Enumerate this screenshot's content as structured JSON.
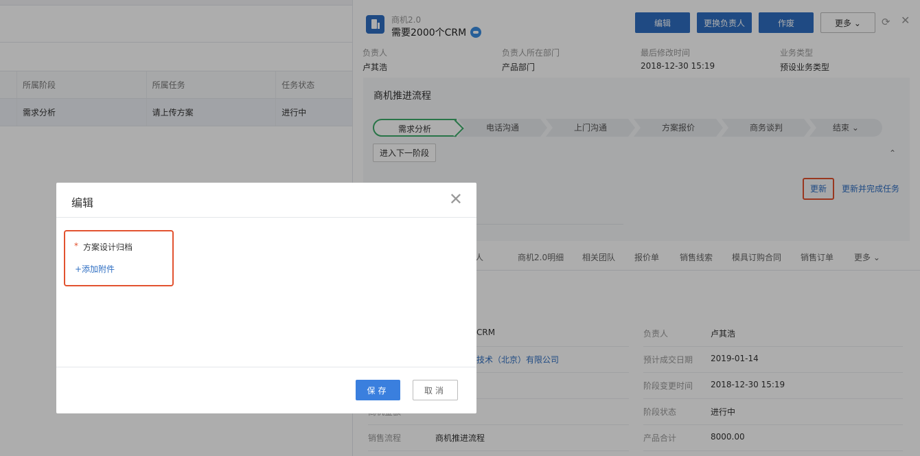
{
  "list": {
    "columns": [
      "所属阶段",
      "所属任务",
      "任务状态"
    ],
    "rows": [
      [
        "需求分析",
        "请上传方案",
        "进行中"
      ]
    ]
  },
  "detail": {
    "object_type": "商机2.0",
    "object_name": "需要2000个CRM",
    "buttons": {
      "edit": "编辑",
      "change_owner": "更换负责人",
      "void": "作废",
      "more": "更多"
    },
    "info": [
      {
        "label": "负责人",
        "value": "卢其浩"
      },
      {
        "label": "负责人所在部门",
        "value": "产品部门"
      },
      {
        "label": "最后修改时间",
        "value": "2018-12-30 15:19"
      },
      {
        "label": "业务类型",
        "value": "预设业务类型"
      }
    ],
    "process": {
      "title": "商机推进流程",
      "stages": [
        "需求分析",
        "电话沟通",
        "上门沟通",
        "方案报价",
        "商务谈判",
        "结束"
      ],
      "next_button": "进入下一阶段",
      "update_link": "更新",
      "update_complete_link": "更新并完成任务"
    },
    "related_tabs": [
      "联系人",
      "商机2.0明细",
      "相关团队",
      "报价单",
      "销售线索",
      "模具订购合同",
      "销售订单",
      "更多"
    ],
    "fields_left": [
      {
        "label": "",
        "value": "CRM"
      },
      {
        "label": "",
        "value": "技术（北京）有限公司"
      },
      {
        "label": "",
        "value": ""
      },
      {
        "label": "商机金额",
        "value": ""
      },
      {
        "label": "销售流程",
        "value": "商机推进流程"
      }
    ],
    "fields_right": [
      {
        "label": "负责人",
        "value": "卢其浩"
      },
      {
        "label": "预计成交日期",
        "value": "2019-01-14"
      },
      {
        "label": "阶段变更时间",
        "value": "2018-12-30 15:19"
      },
      {
        "label": "阶段状态",
        "value": "进行中"
      },
      {
        "label": "产品合计",
        "value": "8000.00"
      }
    ]
  },
  "modal": {
    "title": "编辑",
    "required_mark": "*",
    "field_label": "方案设计归档",
    "add_attachment": "+添加附件",
    "save": "保存",
    "cancel": "取消"
  },
  "colors": {
    "primary": "#2e6ec2",
    "highlight_border": "#e2522f",
    "active_stage": "#3bab69"
  }
}
